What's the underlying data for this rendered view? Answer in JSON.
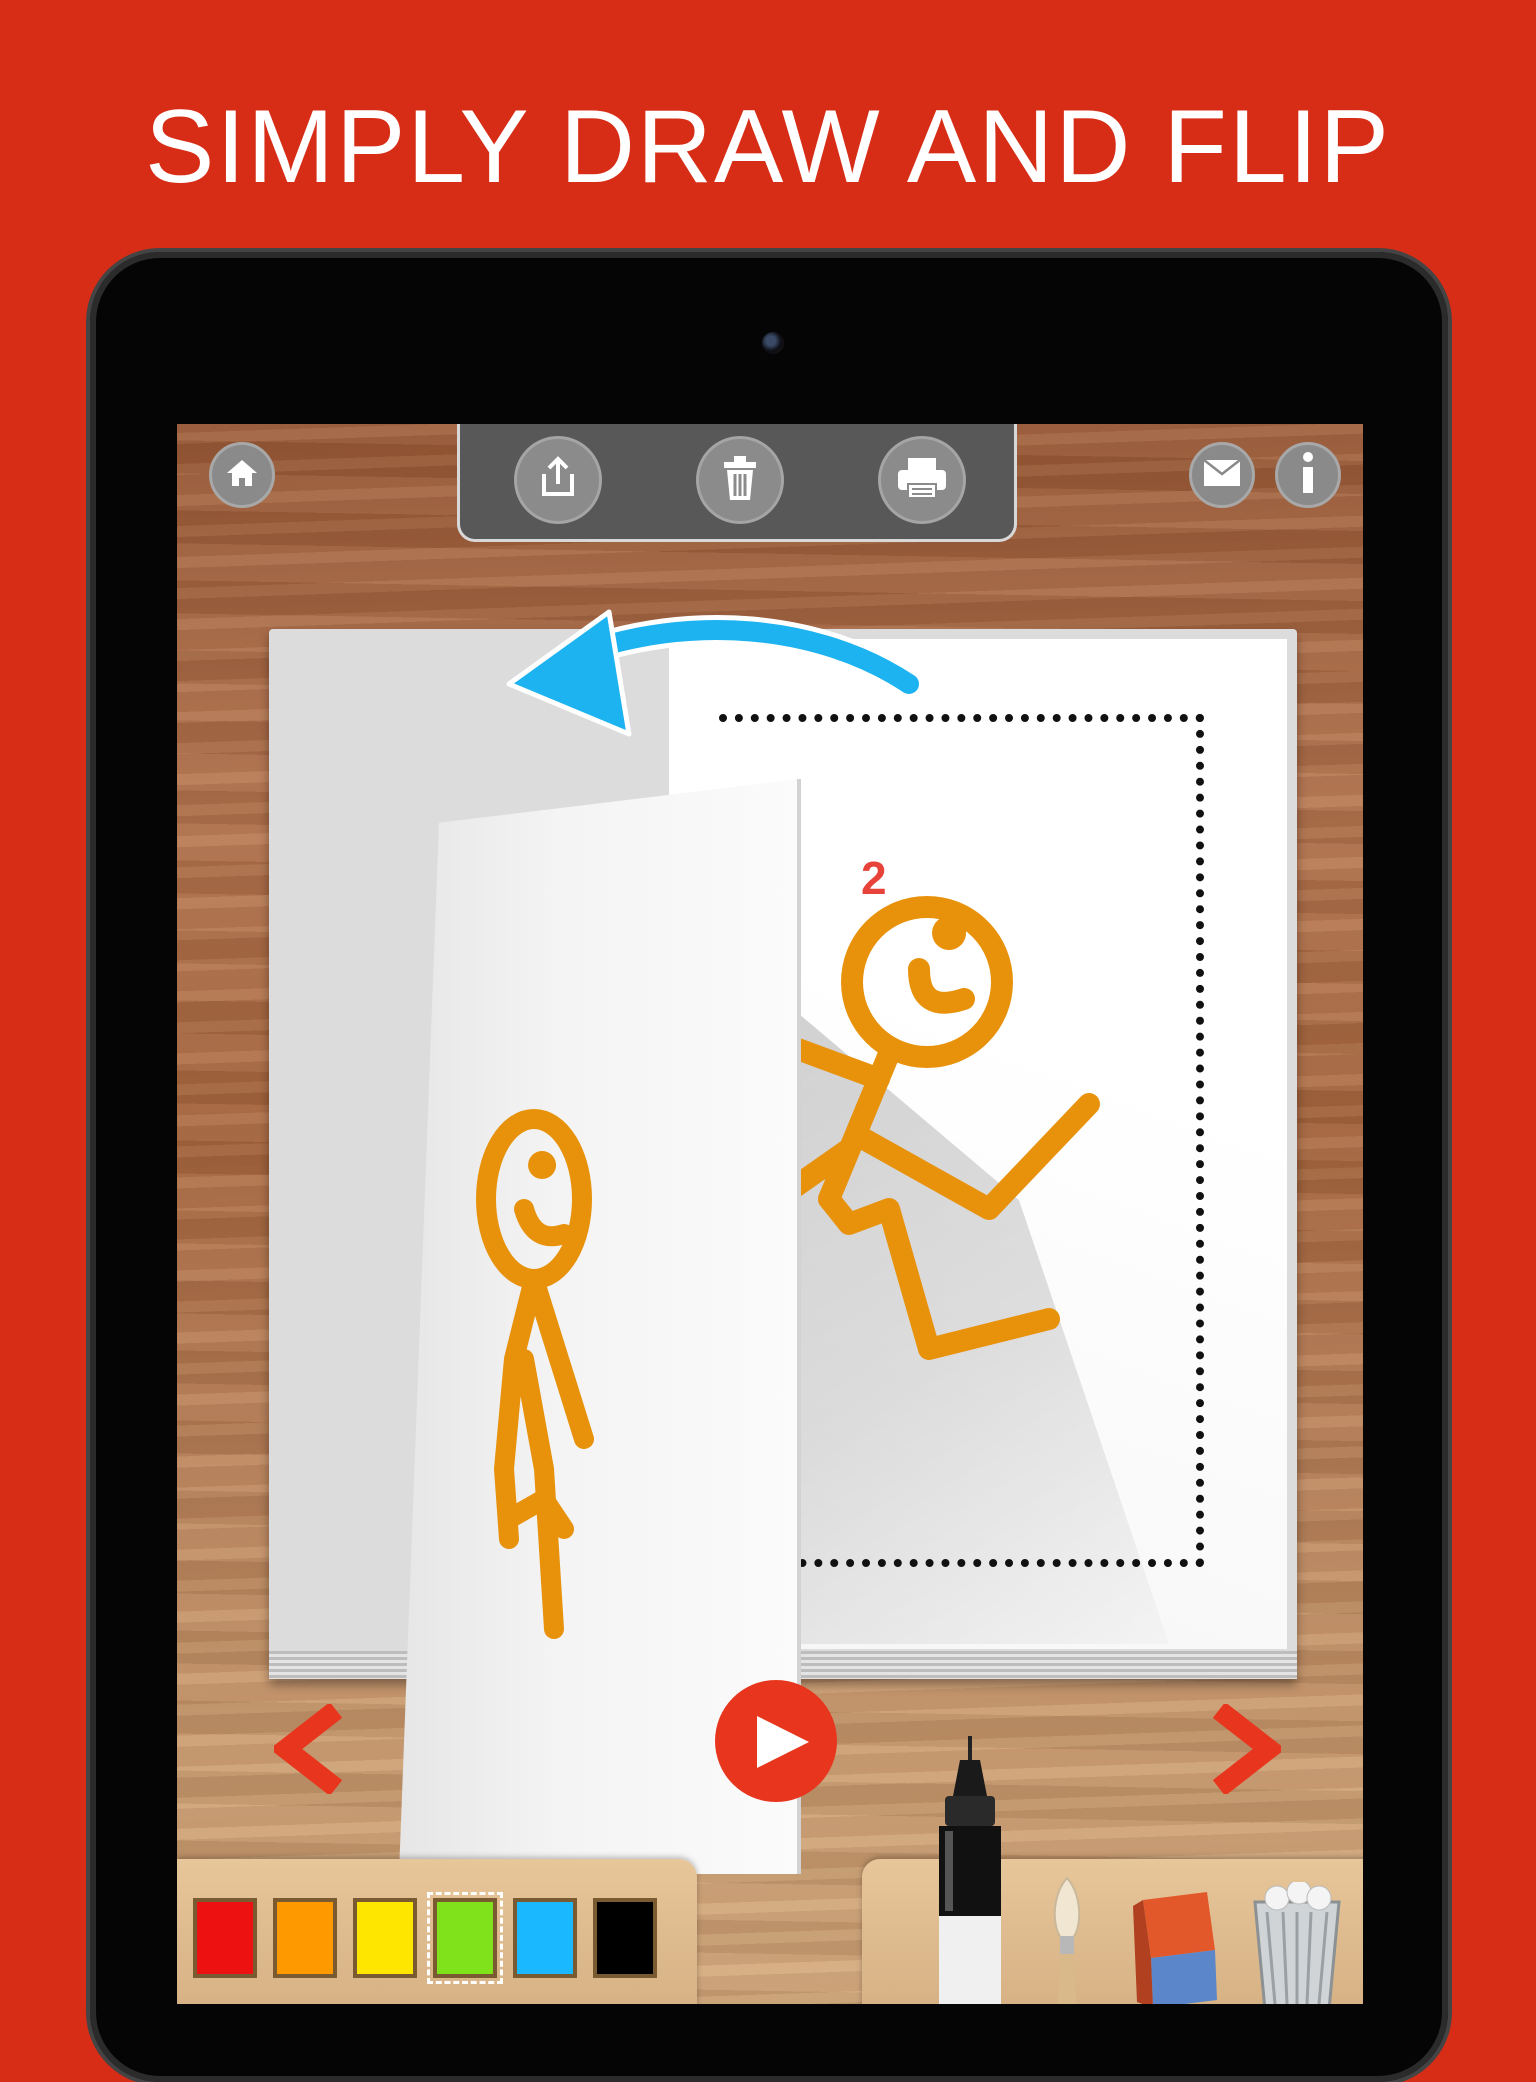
{
  "headline": "SIMPLY DRAW AND FLIP",
  "toolbar": {
    "buttons": [
      {
        "name": "share-icon"
      },
      {
        "name": "trash-icon"
      },
      {
        "name": "print-icon"
      }
    ]
  },
  "corner_buttons": {
    "left": "home-icon",
    "right": [
      "mail-icon",
      "info-icon"
    ]
  },
  "book": {
    "current_page": "2",
    "drawing_color": "#e8920c"
  },
  "playback": {
    "prev": "chevron-left-icon",
    "play": "play-icon",
    "next": "chevron-right-icon",
    "accent": "#e8361e"
  },
  "palette": {
    "colors": [
      "#ee1111",
      "#ff9900",
      "#ffe600",
      "#7fe21a",
      "#1ab8ff",
      "#000000"
    ],
    "selected_index": 3
  },
  "tools": [
    "marker-pen",
    "paint-brush",
    "eraser",
    "clear-bin"
  ],
  "colors": {
    "background": "#d72d17",
    "arrow": "#1cb3f0"
  }
}
